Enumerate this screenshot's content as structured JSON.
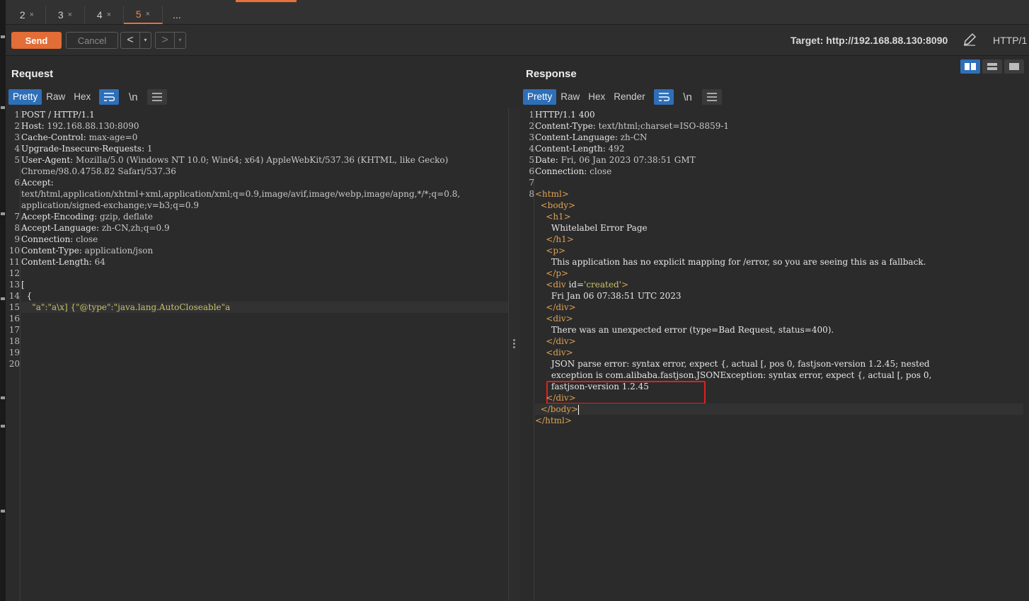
{
  "tabs": [
    {
      "label": "2",
      "close": "×"
    },
    {
      "label": "3",
      "close": "×"
    },
    {
      "label": "4",
      "close": "×"
    },
    {
      "label": "5",
      "close": "×"
    },
    {
      "label": "..."
    }
  ],
  "toolbar": {
    "send": "Send",
    "cancel": "Cancel",
    "back": "<",
    "forward": ">",
    "dropdown": "▾",
    "target": "Target: http://192.168.88.130:8090",
    "protocol": "HTTP/1"
  },
  "request": {
    "title": "Request",
    "view_tabs": [
      "Pretty",
      "Raw",
      "Hex"
    ],
    "icons": [
      "wrap-icon",
      "newline-icon",
      "menu-icon"
    ],
    "newline_glyph": "\\n",
    "lines": [
      {
        "n": "1",
        "k": "POST / HTTP/1.1",
        "v": ""
      },
      {
        "n": "2",
        "k": "Host: ",
        "v": "192.168.88.130:8090"
      },
      {
        "n": "3",
        "k": "Cache-Control: ",
        "v": "max-age=0"
      },
      {
        "n": "4",
        "k": "Upgrade-Insecure-Requests: ",
        "v": "1"
      },
      {
        "n": "5",
        "k": "User-Agent: ",
        "v": "Mozilla/5.0 (Windows NT 10.0; Win64; x64) AppleWebKit/537.36 (KHTML, like Gecko)"
      },
      {
        "n": "",
        "k": "",
        "v": "Chrome/98.0.4758.82 Safari/537.36"
      },
      {
        "n": "6",
        "k": "Accept: ",
        "v": ""
      },
      {
        "n": "",
        "k": "",
        "v": "text/html,application/xhtml+xml,application/xml;q=0.9,image/avif,image/webp,image/apng,*/*;q=0.8,"
      },
      {
        "n": "",
        "k": "",
        "v": "application/signed-exchange;v=b3;q=0.9"
      },
      {
        "n": "7",
        "k": "Accept-Encoding: ",
        "v": "gzip, deflate"
      },
      {
        "n": "8",
        "k": "Accept-Language: ",
        "v": "zh-CN,zh;q=0.9"
      },
      {
        "n": "9",
        "k": "Connection: ",
        "v": "close"
      },
      {
        "n": "10",
        "k": "Content-Type: ",
        "v": "application/json"
      },
      {
        "n": "11",
        "k": "Content-Length: ",
        "v": "64"
      },
      {
        "n": "12",
        "k": "",
        "v": ""
      },
      {
        "n": "13",
        "k": "[",
        "v": ""
      },
      {
        "n": "14",
        "k": "  {",
        "v": ""
      },
      {
        "n": "15",
        "k": "",
        "v": "",
        "str": "    \"a\":\"a\\x] {\"@type\":\"java.lang.AutoCloseable\"a"
      },
      {
        "n": "16",
        "k": "",
        "v": ""
      },
      {
        "n": "17",
        "k": "",
        "v": ""
      },
      {
        "n": "18",
        "k": "",
        "v": ""
      },
      {
        "n": "19",
        "k": "",
        "v": ""
      },
      {
        "n": "20",
        "k": "",
        "v": ""
      }
    ]
  },
  "response": {
    "title": "Response",
    "view_tabs": [
      "Pretty",
      "Raw",
      "Hex",
      "Render"
    ],
    "icons": [
      "wrap-icon",
      "newline-icon",
      "menu-icon"
    ],
    "newline_glyph": "\\n",
    "lines": [
      {
        "n": "1",
        "k": "HTTP/1.1 400",
        "v": ""
      },
      {
        "n": "2",
        "k": "Content-Type: ",
        "v": "text/html;charset=ISO-8859-1"
      },
      {
        "n": "3",
        "k": "Content-Language: ",
        "v": "zh-CN"
      },
      {
        "n": "4",
        "k": "Content-Length: ",
        "v": "492"
      },
      {
        "n": "5",
        "k": "Date: ",
        "v": "Fri, 06 Jan 2023 07:38:51 GMT"
      },
      {
        "n": "6",
        "k": "Connection: ",
        "v": "close"
      },
      {
        "n": "7",
        "k": "",
        "v": ""
      },
      {
        "n": "8",
        "t": "<html>"
      },
      {
        "n": "",
        "t": "  <body>"
      },
      {
        "n": "",
        "t": "    <h1>"
      },
      {
        "n": "",
        "k": "      Whitelabel Error Page"
      },
      {
        "n": "",
        "t": "    </h1>"
      },
      {
        "n": "",
        "t": "    <p>"
      },
      {
        "n": "",
        "k": "      This application has no explicit mapping for /error, so you are seeing this as a fallback."
      },
      {
        "n": "",
        "t": "    </p>"
      },
      {
        "n": "",
        "t": "    <div",
        "k": " id=",
        "s": "'created'",
        "t2": ">"
      },
      {
        "n": "",
        "k": "      Fri Jan 06 07:38:51 UTC 2023"
      },
      {
        "n": "",
        "t": "    </div>"
      },
      {
        "n": "",
        "t": "    <div>"
      },
      {
        "n": "",
        "k": "      There was an unexpected error (type=Bad Request, status=400)."
      },
      {
        "n": "",
        "t": "    </div>"
      },
      {
        "n": "",
        "t": "    <div>"
      },
      {
        "n": "",
        "k": "      JSON parse error: syntax error, expect {, actual [, pos 0, fastjson-version 1.2.45; nested"
      },
      {
        "n": "",
        "k": "      exception is com.alibaba.fastjson.JSONException: syntax error, expect {, actual [, pos 0,"
      },
      {
        "n": "",
        "k": "      fastjson-version 1.2.45"
      },
      {
        "n": "",
        "t": "    </div>"
      },
      {
        "n": "",
        "t": "  </body>",
        "caret": true
      },
      {
        "n": "",
        "t": "</html>"
      }
    ]
  },
  "colors": {
    "accent": "#e26d36",
    "selected": "#2f6fb8",
    "highlight_box": "#e02020"
  }
}
